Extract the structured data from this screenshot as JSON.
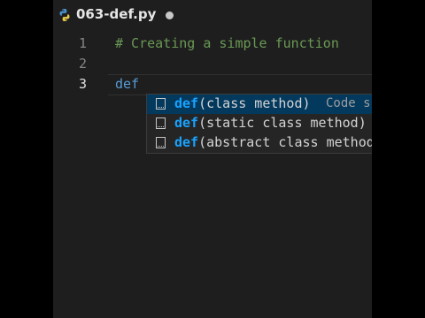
{
  "tab": {
    "title": "063-def.py",
    "icon": "python-icon"
  },
  "gutter": [
    "1",
    "2",
    "3"
  ],
  "code": {
    "line1": "# Creating a simple function",
    "line3": "def"
  },
  "suggestions": [
    {
      "match": "def",
      "rest": "(class method)",
      "detail": "Code s",
      "icon": "snippet-icon"
    },
    {
      "match": "def",
      "rest": "(static class method)",
      "icon": "snippet-icon"
    },
    {
      "match": "def",
      "rest": "(abstract class method)",
      "icon": "snippet-icon"
    }
  ],
  "colors": {
    "background": "#1e1e1e",
    "comment": "#6a9955",
    "keyword": "#569cd6",
    "match": "#18a3ff",
    "selected_row": "#04395e"
  }
}
